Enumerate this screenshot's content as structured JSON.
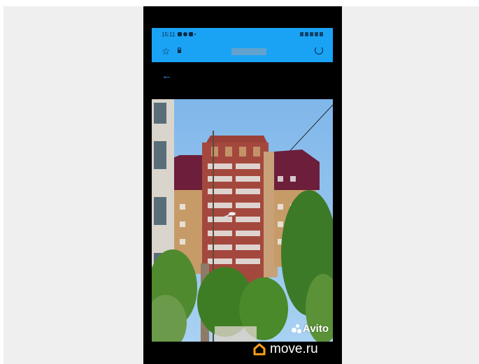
{
  "status_bar": {
    "time": "15:11"
  },
  "photo_watermark": "Avito",
  "brand": "move.ru",
  "colors": {
    "browser_bar": "#1aa3f5",
    "back_arrow": "#2f8ff0",
    "brand_orange": "#ff9f1a"
  },
  "icons": [
    "star-icon",
    "lock-icon",
    "reload-icon",
    "back-arrow-icon",
    "avito-logo-icon",
    "move-ru-house-icon"
  ]
}
